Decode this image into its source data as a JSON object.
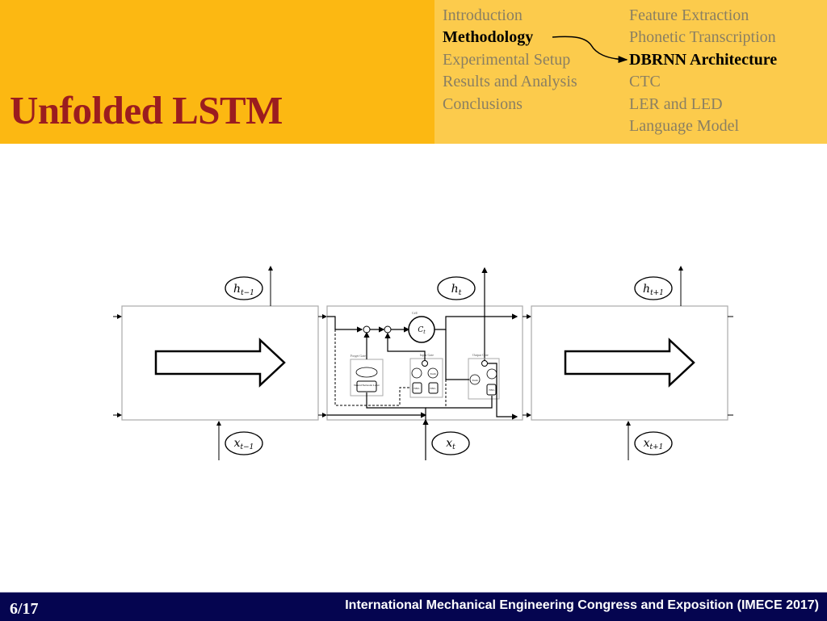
{
  "slide": {
    "title": "Unfolded LSTM"
  },
  "nav": {
    "sections": [
      {
        "label": "Introduction",
        "active": false
      },
      {
        "label": "Methodology",
        "active": true
      },
      {
        "label": "Experimental Setup",
        "active": false
      },
      {
        "label": "Results and Analysis",
        "active": false
      },
      {
        "label": "Conclusions",
        "active": false
      }
    ],
    "subsections": [
      {
        "label": "Feature Extraction",
        "active": false
      },
      {
        "label": "Phonetic Transcription",
        "active": false
      },
      {
        "label": "DBRNN Architecture",
        "active": true
      },
      {
        "label": "CTC",
        "active": false
      },
      {
        "label": "LER and LED",
        "active": false
      },
      {
        "label": "Language Model",
        "active": false
      }
    ]
  },
  "diagram": {
    "outputs": [
      "h_{t-1}",
      "h_t",
      "h_{t+1}"
    ],
    "output_labels": {
      "prev_base": "h",
      "prev_sub": "t−1",
      "cur_base": "h",
      "cur_sub": "t",
      "next_base": "h",
      "next_sub": "t+1"
    },
    "input_labels": {
      "prev_base": "x",
      "prev_sub": "t−1",
      "cur_base": "x",
      "cur_sub": "t",
      "next_base": "x",
      "next_sub": "t+1"
    },
    "cell_label_base": "C",
    "cell_label_sub": "t",
    "cell_caption": "Cell",
    "forget_gate": "Forget Gate",
    "input_gate": "Input Gate",
    "output_gate": "Output Gate",
    "neural_layer": "Neural Network Layer",
    "nnl": "NNL",
    "tanh": "Tanh",
    "sigmoid": "1/(1+e^-x)"
  },
  "footer": {
    "page": "6/17",
    "conference": "International Mechanical Engineering Congress and Exposition (IMECE 2017)"
  },
  "colors": {
    "header_left": "#fcb812",
    "header_right": "#fccb4c",
    "title": "#9b1c1f",
    "footer": "#050550"
  }
}
